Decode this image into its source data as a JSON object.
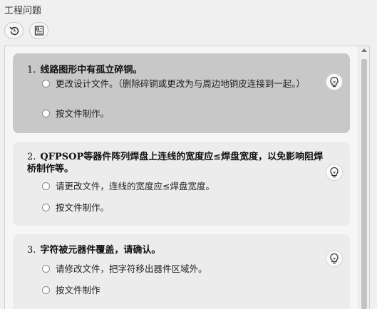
{
  "window": {
    "title": "工程问题"
  },
  "toolbar": {
    "refresh_icon": "refresh-icon",
    "document_icon": "document-icon"
  },
  "issues": [
    {
      "number": "1.",
      "title": "线路图形中有孤立碎铜。",
      "options": [
        "更改设计文件。（删除碎铜或更改为与周边地铜皮连接到一起。）",
        "按文件制作。"
      ]
    },
    {
      "number": "2.",
      "title": "QFPSOP等器件阵列焊盘上连线的宽度应≤焊盘宽度，以免影响阻焊桥制作等。",
      "options": [
        "请更改文件，连线的宽度应≤焊盘宽度。",
        "按文件制作。"
      ]
    },
    {
      "number": "3.",
      "title": "字符被元器件覆盖，请确认。",
      "options": [
        "请修改文件，把字符移出器件区域外。",
        "按文件制作"
      ]
    }
  ],
  "colors": {
    "active_card": "#c8c8c8",
    "card": "#ececec",
    "background": "#f0f0f0"
  }
}
